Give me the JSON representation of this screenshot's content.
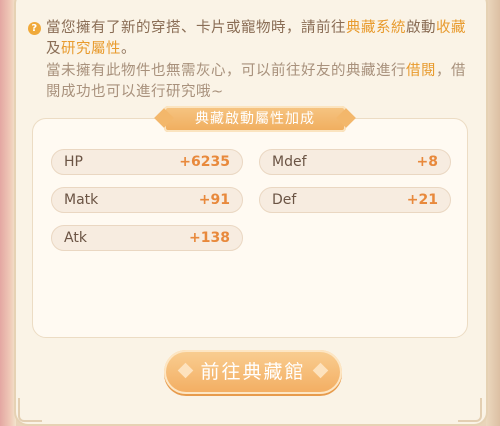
{
  "info": {
    "line1_a": "當您擁有了新的穿搭、卡片或寵物時，請前往",
    "line1_hl1": "典藏系統",
    "line1_b": "啟動",
    "line1_hl2": "收藏",
    "line1_c": "及",
    "line1_hl3": "研究屬性",
    "line1_d": "。",
    "line2_a": "當未擁有此物件也無需灰心，可以前往好友的典藏進行",
    "line2_hl": "借閱",
    "line2_b": "，借閱成功也可以進行研究哦~"
  },
  "panel_title": "典藏啟動屬性加成",
  "stats": [
    {
      "name": "HP",
      "value": "+6235"
    },
    {
      "name": "Mdef",
      "value": "+8"
    },
    {
      "name": "Matk",
      "value": "+91"
    },
    {
      "name": "Def",
      "value": "+21"
    },
    {
      "name": "Atk",
      "value": "+138"
    }
  ],
  "button_label": "前往典藏館",
  "colors": {
    "accent": "#f0ad5d",
    "value": "#e8893c",
    "highlight": "#e89b2e"
  }
}
